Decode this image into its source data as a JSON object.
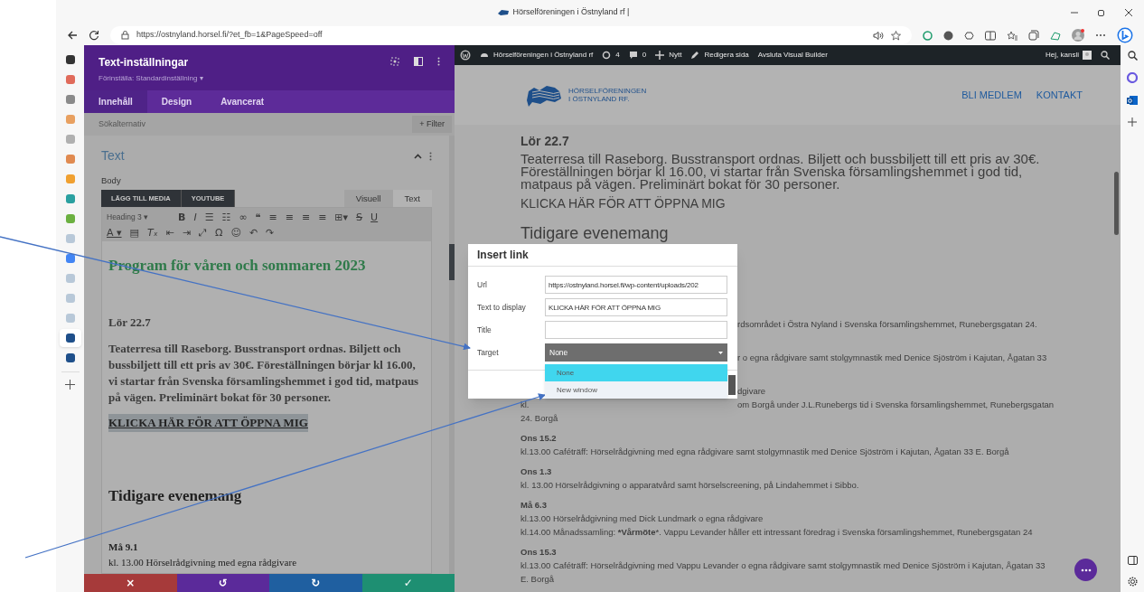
{
  "browser": {
    "title": "Hörselföreningen i Östnyland rf |",
    "url": "https://ostnyland.horsel.fi/?et_fb=1&PageSpeed=off"
  },
  "vertical_tabs": [
    {
      "color": "#333333",
      "selected": false
    },
    {
      "color": "#e06a5a",
      "selected": false
    },
    {
      "color": "#8a8a8a",
      "selected": false
    },
    {
      "color": "#e8a060",
      "selected": false
    },
    {
      "color": "#b0b0b0",
      "selected": false
    },
    {
      "color": "#e08a50",
      "selected": false
    },
    {
      "color": "#f0a030",
      "selected": false
    },
    {
      "color": "#2aa0a0",
      "selected": false
    },
    {
      "color": "#6bb040",
      "selected": false
    },
    {
      "color": "#b8c8d8",
      "selected": false
    },
    {
      "color": "#4285f4",
      "selected": false
    },
    {
      "color": "#b8c8d8",
      "selected": false
    },
    {
      "color": "#b8c8d8",
      "selected": false
    },
    {
      "color": "#b8c8d8",
      "selected": false
    },
    {
      "color": "#1e4f8a",
      "selected": true
    },
    {
      "color": "#1e4f8a",
      "selected": false
    }
  ],
  "settings_panel": {
    "title": "Text-inställningar",
    "preset": "Förinställa: Standardinställning ▾",
    "tabs": [
      {
        "label": "Innehåll",
        "selected": true
      },
      {
        "label": "Design",
        "selected": false
      },
      {
        "label": "Avancerat",
        "selected": false
      }
    ],
    "search": {
      "placeholder": "Sökalternativ"
    },
    "filter_button": "+ Filter",
    "section_title": "Text",
    "expanded": true,
    "field_label": "Body",
    "media_buttons": [
      "LÄGG TILL MEDIA",
      "YOUTUBE"
    ],
    "editor_tabs": [
      {
        "label": "Visuell",
        "selected": true
      },
      {
        "label": "Text",
        "selected": false
      }
    ],
    "format_select": "Heading 3 ▾",
    "toolbar": [
      [
        {
          "kind": "bold",
          "glyph": "B"
        },
        {
          "kind": "italic",
          "glyph": "I"
        },
        {
          "kind": "plain",
          "glyph": "☰"
        },
        {
          "kind": "plain",
          "glyph": "☷"
        },
        {
          "kind": "link",
          "glyph": "∞"
        },
        {
          "kind": "plain",
          "glyph": "❝"
        },
        {
          "kind": "plain",
          "glyph": "≡"
        },
        {
          "kind": "plain",
          "glyph": "≡"
        },
        {
          "kind": "plain",
          "glyph": "≡"
        },
        {
          "kind": "plain",
          "glyph": "≡"
        },
        {
          "kind": "plain",
          "glyph": "⊞▾"
        },
        {
          "kind": "strike",
          "glyph": "S"
        },
        {
          "kind": "underline",
          "glyph": "U"
        }
      ],
      [
        {
          "kind": "underline",
          "glyph": "A ▾"
        },
        {
          "kind": "plain",
          "glyph": "▤"
        },
        {
          "kind": "italic",
          "glyph": "Tₓ"
        },
        {
          "kind": "plain",
          "glyph": "⇤"
        },
        {
          "kind": "plain",
          "glyph": "⇥"
        },
        {
          "kind": "plain",
          "glyph": "⤢"
        },
        {
          "kind": "plain",
          "glyph": "Ω"
        },
        {
          "kind": "plain",
          "glyph": "☺"
        },
        {
          "kind": "plain",
          "glyph": "↶"
        },
        {
          "kind": "plain",
          "glyph": "↷"
        }
      ]
    ],
    "editor_content": [
      {
        "kind": "h1",
        "text": "Program för våren och sommaren 2023"
      },
      {
        "kind": "h3",
        "text": "Lör 22.7"
      },
      {
        "kind": "p",
        "text": "Teaterresa till Raseborg. Busstransport ordnas. Biljett och bussbiljett till ett pris av 30€. Föreställningen börjar kl 16.00, vi startar från Svenska församlingshemmet i god tid, matpaus på vägen. Preliminärt bokat för 30 personer."
      },
      {
        "kind": "link",
        "text": "KLICKA HÄR FÖR ATT ÖPPNA MIG"
      },
      {
        "kind": "h2",
        "text": "Tidigare evenemang"
      },
      {
        "kind": "h4",
        "text": "Må 9.1"
      },
      {
        "kind": "small",
        "text": "kl. 13.00 Hörselrådgivning med egna rådgivare"
      }
    ],
    "action_bar": [
      "×",
      "↺",
      "↻",
      "✓"
    ]
  },
  "admin_bar": {
    "site": "Hörselföreningen i Östnyland rf",
    "updates": "4",
    "comments": "0",
    "new": "Nytt",
    "edit": "Redigera sida",
    "exit": "Avsluta Visual Builder",
    "greeting": "Hej, kansli"
  },
  "site_header": {
    "logo_lines": [
      "HÖRSELFÖRENINGEN",
      "I ÖSTNYLAND RF."
    ],
    "nav": [
      "BLI MEDLEM",
      "KONTAKT"
    ]
  },
  "page": {
    "date": "Lör 22.7",
    "paragraph": "Teaterresa till Raseborg. Busstransport ordnas. Biljett och bussbiljett till ett pris av 30€. Föreställningen börjar kl 16.00, vi startar från Svenska församlingshemmet i god tid, matpaus på vägen. Preliminärt bokat för 30 personer.",
    "link": "KLICKA HÄR FÖR ATT ÖPPNA MIG",
    "heading": "Tidigare evenemang",
    "events": [
      {
        "lines": [
          {
            "tail": "rdsområdet i Östra Nyland i Svenska församlingshemmet, Runebergsgatan 24."
          }
        ]
      },
      {
        "lines": [
          {
            "tail": "r o egna rådgivare samt stolgymnastik med Denice Sjöström i Kajutan, Ågatan 33"
          }
        ]
      },
      {
        "lines": [
          {
            "tail": "dgivare"
          },
          {
            "text": "kl.",
            "tail": "om Borgå under J.L.Runebergs tid i Svenska församlingshemmet, Runebergsgatan"
          },
          {
            "text": "24. Borgå"
          }
        ]
      },
      {
        "title": "Ons 15.2",
        "lines": [
          {
            "text": "kl.13.00 Caféträff: Hörselrådgivning med egna rådgivare samt stolgymnastik med Denice Sjöström i Kajutan, Ågatan 33 E. Borgå"
          }
        ]
      },
      {
        "title": "Ons 1.3",
        "lines": [
          {
            "text": "kl. 13.00 Hörselrådgivning o apparatvård samt hörselscreening, på Lindahemmet i Sibbo."
          }
        ]
      },
      {
        "title": "Må 6.3",
        "lines": [
          {
            "text": "kl.13.00 Hörselrådgivning med Dick Lundmark o egna rådgivare"
          },
          {
            "text": "kl.14.00 Månadssamling: ***Vårmöte***. Vappu Levander håller ett intressant föredrag i Svenska församlingshemmet, Runebergsgatan 24"
          }
        ]
      },
      {
        "title": "Ons 15.3",
        "lines": [
          {
            "text": "kl.13.00 Caféträff: Hörselrådgivning med Vappu Levander o egna rådgivare samt stolgymnastik med Denice Sjöström i Kajutan, Ågatan 33 E. Borgå"
          }
        ]
      }
    ]
  },
  "dialog": {
    "title": "Insert link",
    "fields": [
      {
        "label": "Url",
        "value": "https://ostnyland.horsel.fi/wp-content/uploads/202"
      },
      {
        "label": "Text to display",
        "value": "KLICKA HÄR FÖR ATT ÖPPNA MIG"
      },
      {
        "label": "Title"
      },
      {
        "label": "Target",
        "kind": "select",
        "value": "None",
        "expanded": true,
        "options": [
          {
            "label": "None",
            "selected": true
          },
          {
            "label": "New window",
            "selected": false
          }
        ]
      }
    ]
  }
}
